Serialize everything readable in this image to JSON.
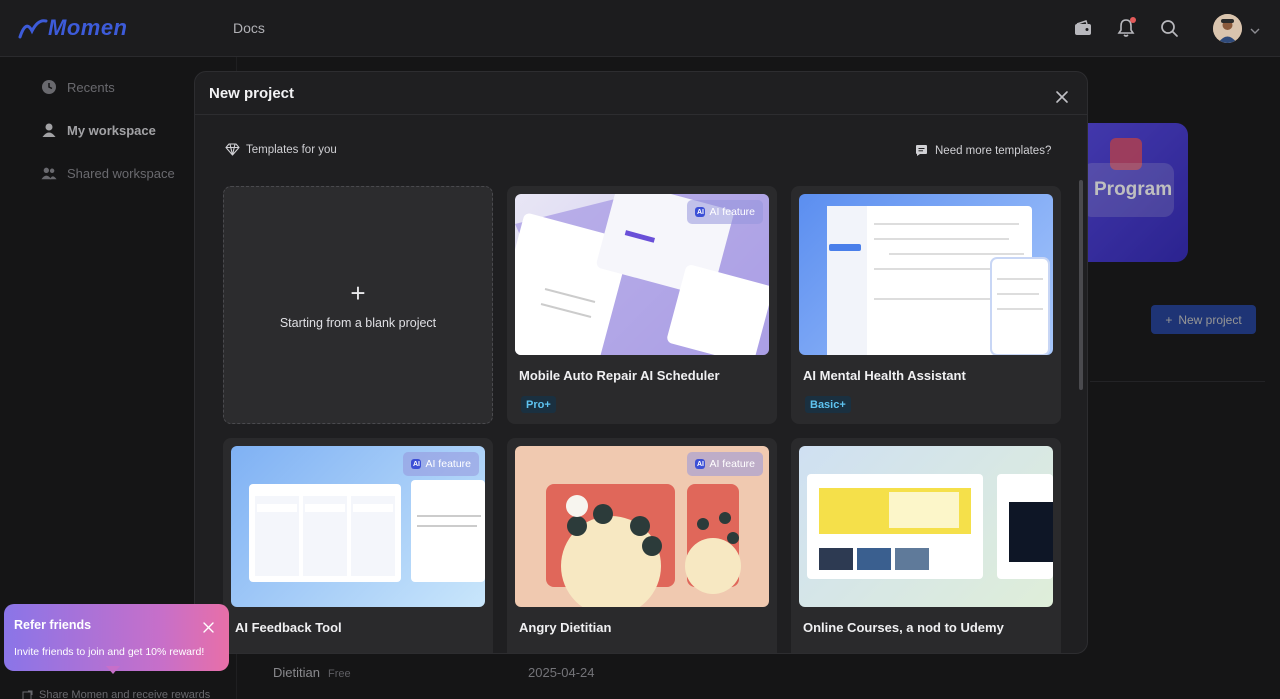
{
  "topbar": {
    "logo_text": "Momen",
    "docs_label": "Docs"
  },
  "sidebar": {
    "items": [
      {
        "label": "Recents",
        "icon": "clock-icon"
      },
      {
        "label": "My workspace",
        "icon": "user-icon"
      },
      {
        "label": "Shared workspace",
        "icon": "users-icon"
      }
    ]
  },
  "background": {
    "card_label": "Program",
    "new_project_label": "New project",
    "row_name": "Dietitian",
    "row_badge": "Free",
    "row_date": "2025-04-24",
    "share_label": "Share Momen and receive rewards"
  },
  "modal": {
    "title": "New project",
    "templates_label": "Templates for you",
    "more_templates_label": "Need more templates?",
    "blank_label": "Starting from a blank project",
    "ai_chip_label": "AI feature",
    "cards": [
      {
        "title": "Mobile Auto Repair AI Scheduler",
        "badge": "Pro+"
      },
      {
        "title": "AI Mental Health Assistant",
        "badge": "Basic+"
      },
      {
        "title": "AI Feedback Tool"
      },
      {
        "title": "Angry Dietitian"
      },
      {
        "title": "Online Courses, a nod to Udemy"
      }
    ]
  },
  "refer": {
    "title": "Refer friends",
    "text": "Invite friends to join and get 10% reward!"
  },
  "colors": {
    "accent": "#2c55c8",
    "badge_text": "#5ec3f0",
    "brand": "#3d5bd9"
  }
}
